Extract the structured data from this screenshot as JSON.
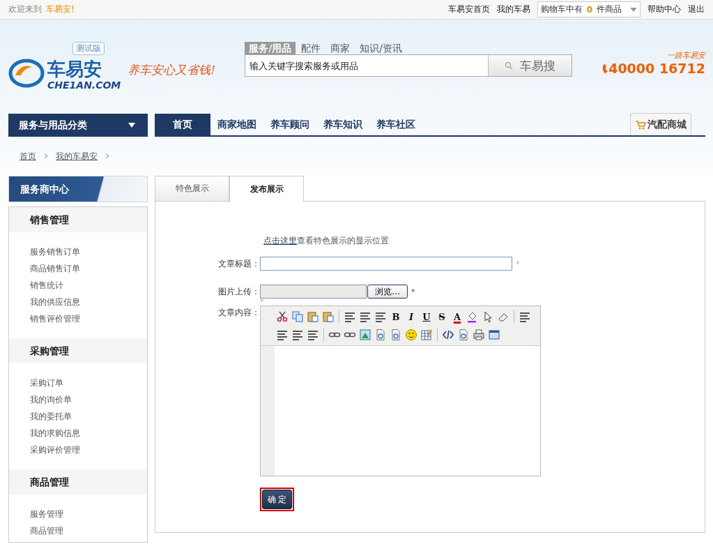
{
  "topbar": {
    "welcome": "欢迎来到",
    "site": "车易安!",
    "links": [
      {
        "label": "车易安首页"
      },
      {
        "label": "我的车易"
      }
    ],
    "cart": {
      "prefix": "购物车中有",
      "count": "0",
      "suffix": "件商品"
    },
    "links_right": [
      {
        "label": "帮助中心"
      },
      {
        "label": "退出"
      }
    ]
  },
  "header": {
    "logo": {
      "name": "车易安",
      "domain": "CHE1AN.COM",
      "badge": "测试版"
    },
    "slogan": "养车安心又省钱!",
    "search": {
      "tabs": [
        {
          "label": "服务/用品",
          "selected": true
        },
        {
          "label": "配件",
          "selected": false
        },
        {
          "label": "商家",
          "selected": false
        },
        {
          "label": "知识/资讯",
          "selected": false
        }
      ],
      "placeholder": "输入关键字搜索服务或用品",
      "button": "车易搜"
    },
    "hotline": {
      "caption": "一路车易安",
      "number": "40000 16712"
    }
  },
  "nav": {
    "category": "服务与用品分类",
    "items": [
      {
        "label": "首页",
        "selected": true
      },
      {
        "label": "商家地图",
        "selected": false
      },
      {
        "label": "养车顾问",
        "selected": false
      },
      {
        "label": "养车知识",
        "selected": false
      },
      {
        "label": "养车社区",
        "selected": false
      }
    ],
    "mall": "汽配商城"
  },
  "breadcrumb": [
    "首页",
    "我的车易安"
  ],
  "sidebar": {
    "title": "服务商中心",
    "groups": [
      {
        "title": "销售管理",
        "items": [
          "服务销售订单",
          "商品销售订单",
          "销售统计",
          "我的供应信息",
          "销售评价管理"
        ]
      },
      {
        "title": "采购管理",
        "items": [
          "采购订单",
          "我的询价单",
          "我的委托单",
          "我的求购信息",
          "采购评价管理"
        ]
      },
      {
        "title": "商品管理",
        "items": [
          "服务管理",
          "商品管理"
        ]
      }
    ]
  },
  "tabs": [
    {
      "label": "特色展示",
      "selected": false
    },
    {
      "label": "发布展示",
      "selected": true
    }
  ],
  "form": {
    "hint_link": "点击这里",
    "hint_text": "查看特色展示的显示位置",
    "title_label": "文章标题：",
    "upload_label": "图片上传：",
    "browse": "浏览…",
    "content_label": "文章内容：",
    "submit": "确 定",
    "required_marks": [
      "*",
      "*",
      "*"
    ],
    "toolbar": [
      [
        {
          "kind": "icon"
        },
        {
          "kind": "icon"
        },
        {
          "kind": "icon"
        },
        {
          "kind": "icon"
        },
        {
          "kind": "sep"
        },
        {
          "kind": "icon"
        },
        {
          "kind": "icon"
        },
        {
          "kind": "icon"
        },
        {
          "kind": "glyph",
          "text": "B"
        },
        {
          "kind": "glyph",
          "text": "I"
        },
        {
          "kind": "glyph",
          "text": "U"
        },
        {
          "kind": "glyph",
          "text": "S"
        },
        {
          "kind": "glyph",
          "text": "A"
        },
        {
          "kind": "icon"
        },
        {
          "kind": "icon"
        },
        {
          "kind": "icon"
        },
        {
          "kind": "sep"
        },
        {
          "kind": "icon"
        }
      ],
      [
        {
          "kind": "icon"
        },
        {
          "kind": "icon"
        },
        {
          "kind": "icon"
        },
        {
          "kind": "sep"
        },
        {
          "kind": "icon"
        },
        {
          "kind": "icon"
        },
        {
          "kind": "icon"
        },
        {
          "kind": "icon"
        },
        {
          "kind": "icon"
        },
        {
          "kind": "icon"
        },
        {
          "kind": "icon"
        },
        {
          "kind": "sep"
        },
        {
          "kind": "icon"
        },
        {
          "kind": "icon"
        },
        {
          "kind": "icon"
        },
        {
          "kind": "icon"
        }
      ]
    ]
  }
}
